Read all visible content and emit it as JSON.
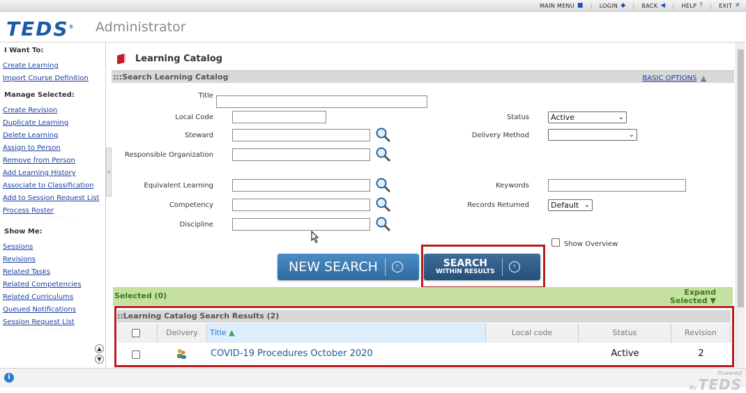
{
  "topnav": {
    "items": [
      {
        "label": "MAIN MENU",
        "icon": "square-icon"
      },
      {
        "label": "LOGIN",
        "icon": "diamond-icon"
      },
      {
        "label": "BACK",
        "icon": "back-arrow-icon"
      },
      {
        "label": "HELP",
        "icon": "question-icon"
      },
      {
        "label": "EXIT",
        "icon": "close-icon"
      }
    ]
  },
  "header": {
    "logo": "TEDS",
    "app_name": "Administrator"
  },
  "sidebar": {
    "want_to_title": "I Want To:",
    "want_to": [
      "Create Learning",
      "Import Course Definition"
    ],
    "manage_title": "Manage Selected:",
    "manage": [
      "Create Revision",
      "Duplicate Learning",
      "Delete Learning",
      "Assign to Person",
      "Remove from Person",
      "Add Learning History",
      "Associate to Classification",
      "Add to Session Request List",
      "Process Roster"
    ],
    "show_title": "Show Me:",
    "show": [
      "Sessions",
      "Revisions",
      "Related Tasks",
      "Related Competencies",
      "Related Curriculums",
      "Queued Notifications",
      "Session Request List"
    ]
  },
  "page": {
    "title": "Learning Catalog"
  },
  "search": {
    "header": ":::Search Learning Catalog",
    "basic_options": "BASIC OPTIONS",
    "fields": {
      "title": "Title",
      "local_code": "Local Code",
      "steward": "Steward",
      "responsible_org": "Responsible Organization",
      "equivalent": "Equivalent Learning",
      "competency": "Competency",
      "discipline": "Discipline",
      "status": "Status",
      "delivery_method": "Delivery Method",
      "keywords": "Keywords",
      "records_returned": "Records Returned"
    },
    "status_value": "Active",
    "delivery_value": "",
    "records_value": "Default",
    "show_overview": "Show Overview",
    "new_search": "NEW SEARCH",
    "search_within_1": "SEARCH",
    "search_within_2": "WITHIN RESULTS"
  },
  "selected": {
    "label": "Selected (0)",
    "expand_1": "Expand",
    "expand_2": "Selected"
  },
  "results": {
    "header": "::Learning Catalog Search Results (2)",
    "columns": [
      "Delivery",
      "Title",
      "Local code",
      "Status",
      "Revision"
    ],
    "rows": [
      {
        "title": "COVID-19 Procedures October 2020",
        "local_code": "",
        "status": "Active",
        "revision": "2"
      }
    ]
  },
  "footer": {
    "powered": "Powered",
    "by": "By",
    "brand": "TEDS"
  },
  "colors": {
    "link": "#1a3fa0",
    "accent": "#1a5aa8",
    "button": "#2d6aa0",
    "highlight": "#b81c1c",
    "selected_bar": "#c6e0a0"
  }
}
